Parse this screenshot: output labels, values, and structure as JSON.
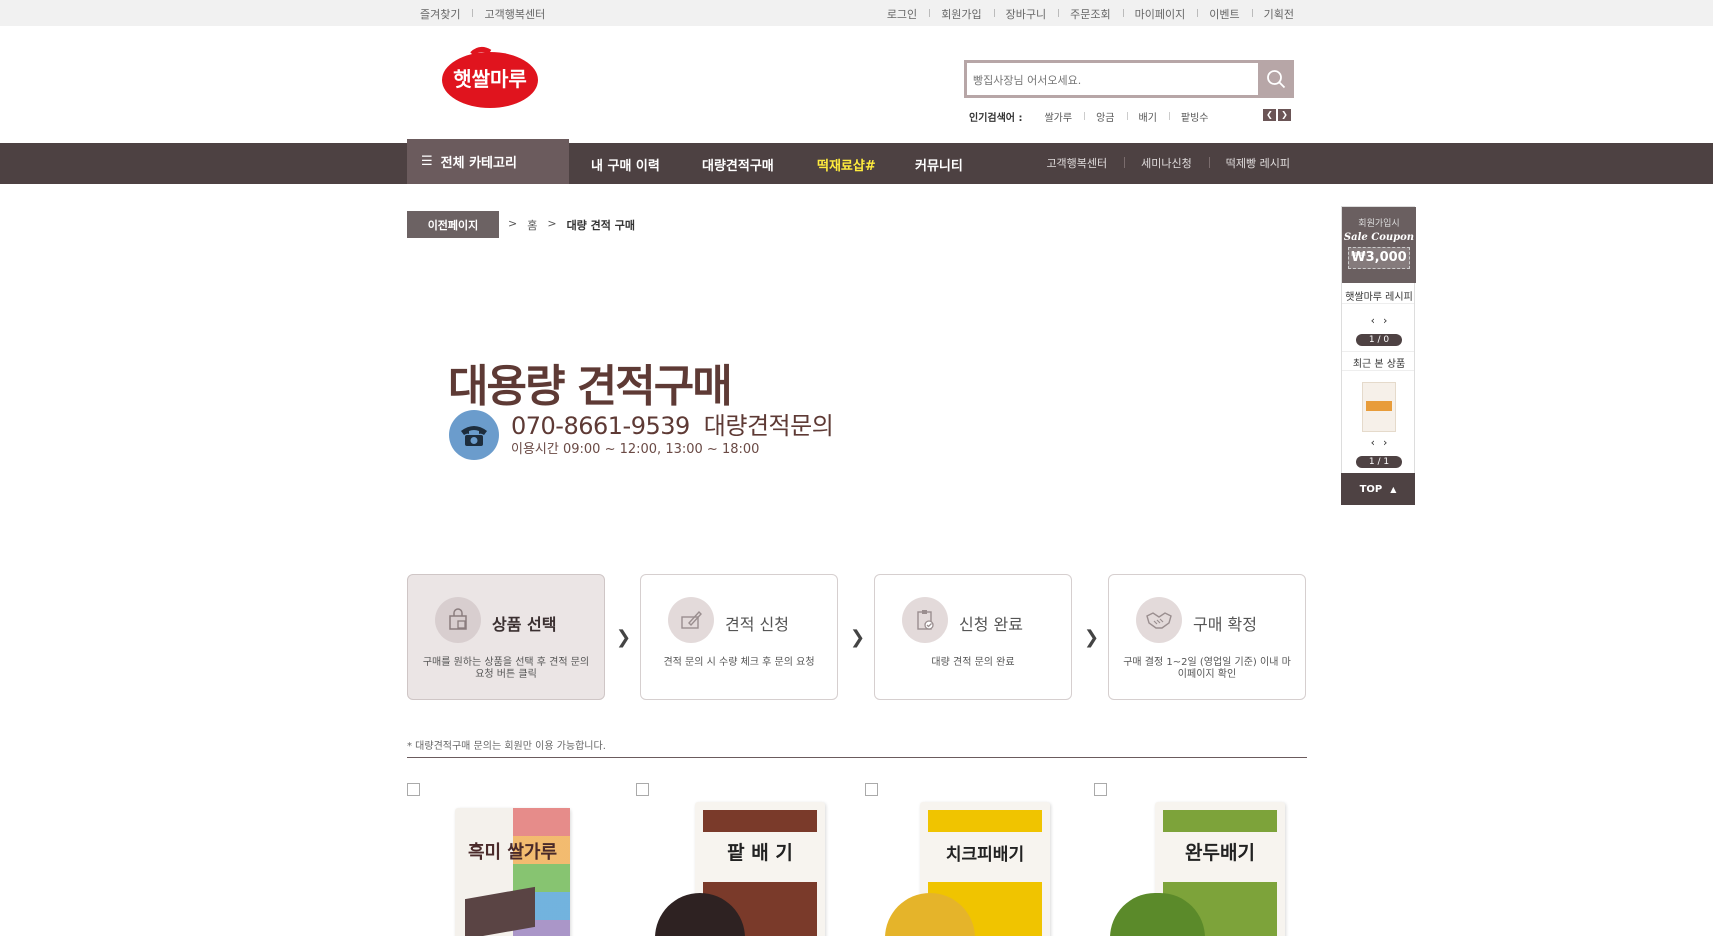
{
  "topbar": {
    "left": [
      "즐겨찾기",
      "고객행복센터"
    ],
    "right": [
      "로그인",
      "회원가입",
      "장바구니",
      "주문조회",
      "마이페이지",
      "이벤트",
      "기획전"
    ]
  },
  "header": {
    "logo_text": "햇쌀마루",
    "search_placeholder": "빵집사장님 어서오세요.",
    "popular_title": "인기검색어 :",
    "popular": [
      "쌀가루",
      "앙금",
      "배기",
      "팥빙수"
    ]
  },
  "gnb": {
    "all_categories": "전체 카테고리",
    "main": [
      "내 구매 이력",
      "대량견적구매",
      "떡재료샵#",
      "커뮤니티"
    ],
    "sub": [
      "고객행복센터",
      "세미나신청",
      "떡제빵 레시피"
    ]
  },
  "breadcrumb": {
    "back": "이전페이지",
    "sep": ">",
    "home": "홈",
    "current": "대량 견적 구매"
  },
  "hero": {
    "title": "대용량 견적구매",
    "phone": "070-8661-9539",
    "phone_label": "대량견적문의",
    "hours": "이용시간 09:00 ~ 12:00, 13:00 ~ 18:00"
  },
  "steps": [
    {
      "title": "상품 선택",
      "desc": "구매를 원하는 상품을 선택 후 견적 문의 요청 버튼 클릭",
      "icon": "shopping-bag-icon"
    },
    {
      "title": "견적 신청",
      "desc": "견적 문의 시 수량 체크 후 문의 요청",
      "icon": "pencil-icon"
    },
    {
      "title": "신청 완료",
      "desc": "대량 견적 문의 완료",
      "icon": "clipboard-check-icon"
    },
    {
      "title": "구매 확정",
      "desc": "구매 결정 1~2일 (영업일 기준) 이내 마이페이지 확인",
      "icon": "handshake-icon"
    }
  ],
  "note": "* 대량견적구매 문의는 회원만 이용 가능합니다.",
  "products": [
    {
      "label": "흑미 쌀가루",
      "color": "#8b7a7a"
    },
    {
      "label": "팥 배 기",
      "color": "#7a3a2a"
    },
    {
      "label": "치크피배기",
      "color": "#f0c400"
    },
    {
      "label": "완두배기",
      "color": "#7da33a"
    }
  ],
  "quick": {
    "coupon_line1": "회원가입시",
    "coupon_line2": "Sale Coupon",
    "coupon_amount": "₩3,000",
    "recipe_label": "햇쌀마루 레시피",
    "recipe_page": "1 / 0",
    "recent_label": "최근 본 상품",
    "recent_page": "1 / 1",
    "top": "TOP"
  },
  "colors": {
    "gnb": "#4d4142",
    "accent": "#6b5b5d",
    "hero": "#5e3a35",
    "highlight": "#ffec3d"
  }
}
